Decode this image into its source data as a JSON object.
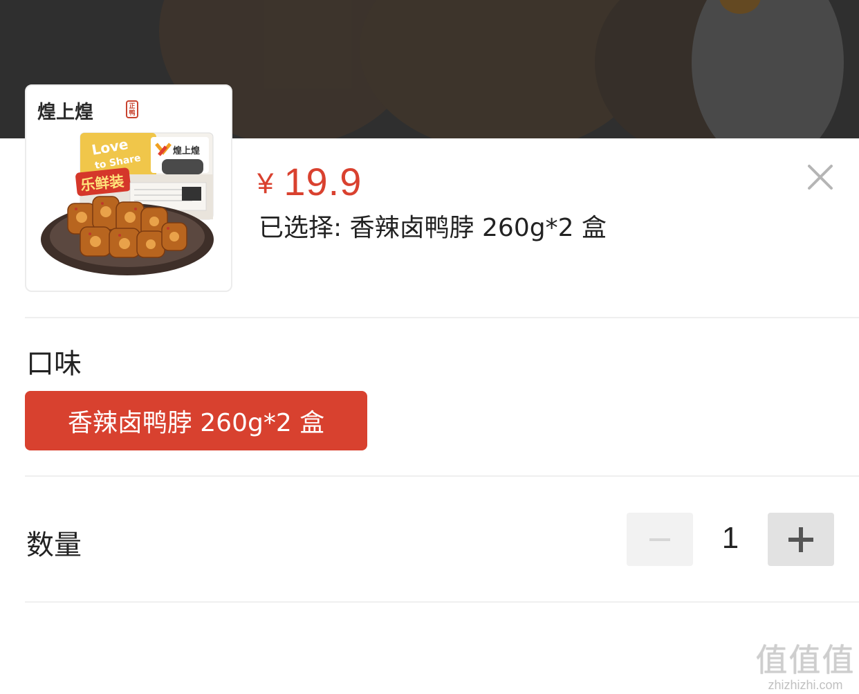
{
  "product": {
    "brand": "煌上煌",
    "brand_seal": "正鸭",
    "package_texts": [
      "Love",
      "to Share",
      "乐鲜装",
      "煌上煌"
    ],
    "price_currency": "¥",
    "price": "19.9",
    "selected_text": "已选择: 香辣卤鸭脖 260g*2 盒"
  },
  "flavor": {
    "title": "口味",
    "options": [
      {
        "label": "香辣卤鸭脖 260g*2 盒",
        "selected": true
      }
    ]
  },
  "quantity": {
    "title": "数量",
    "value": "1"
  },
  "watermark": {
    "logo": "值值值",
    "url": "zhizhizhi.com"
  },
  "colors": {
    "accent": "#d8412f",
    "backdrop": "#3a3a3a",
    "divider": "#efefef"
  },
  "icons": {
    "close": "close-icon",
    "minus": "minus-icon",
    "plus": "plus-icon"
  }
}
